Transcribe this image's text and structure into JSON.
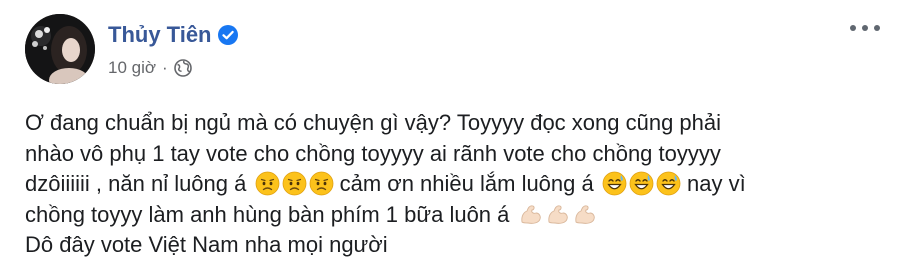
{
  "author": {
    "name": "Thủy Tiên",
    "verified_icon": "verified-badge-icon",
    "verified_color": "#1877f2",
    "name_color": "#385898"
  },
  "meta": {
    "time": "10 giờ",
    "separator": "·",
    "privacy_icon": "globe-icon"
  },
  "more_icon": "more-options-icon",
  "post": {
    "line1": "Ơ đang chuẩn bị ngủ mà có chuyện gì vậy? Toyyyy đọc xong cũng phải",
    "line2": "nhào vô phụ 1 tay vote cho chồng toyyyy ai rãnh vote cho chồng toyyyy",
    "line3_a": "dzôiiiiii , năn nỉ luông á",
    "line3_b": " cảm ơn nhiều lắm luông á",
    "line3_c": " nay vì",
    "line4_a": "chồng toyyy làm anh hùng bàn phím 1 bữa luôn á",
    "line5": "Dô đây vote Việt Nam nha mọi người",
    "emoji": {
      "worried_face": "worried-face-emoji",
      "sweat_smile": "grinning-sweat-emoji",
      "flexed_biceps": "flexed-biceps-emoji"
    }
  }
}
